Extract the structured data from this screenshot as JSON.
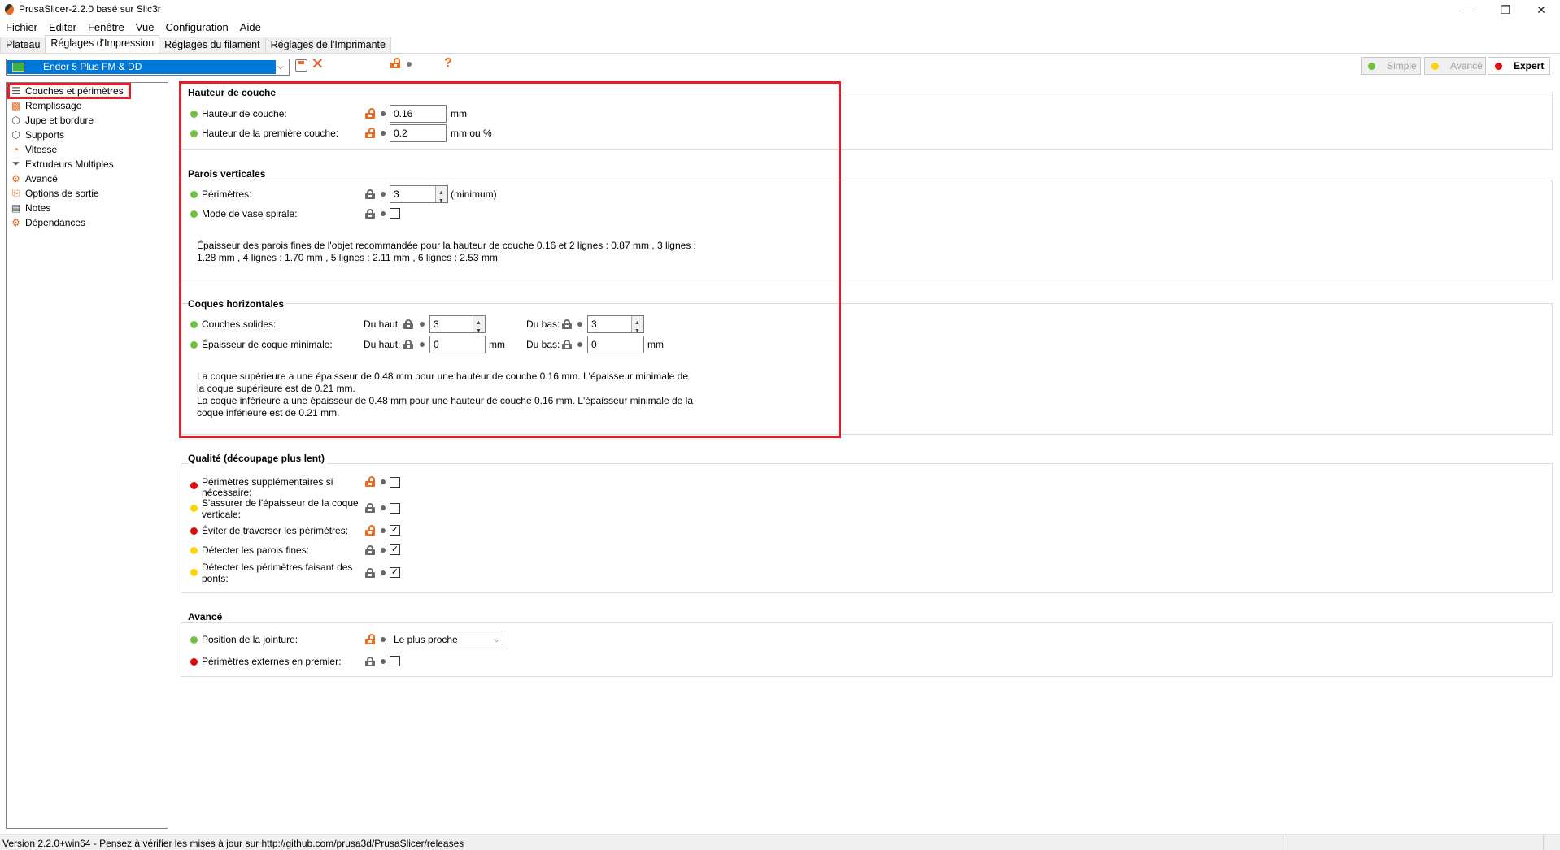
{
  "window": {
    "title": "PrusaSlicer-2.2.0 basé sur Slic3r",
    "minimize": "—",
    "restore": "❐",
    "close": "✕"
  },
  "menu": [
    "Fichier",
    "Editer",
    "Fenêtre",
    "Vue",
    "Configuration",
    "Aide"
  ],
  "tabs": [
    "Plateau",
    "Réglages d'Impression",
    "Réglages du filament",
    "Réglages de l'Imprimante"
  ],
  "toolbar": {
    "preset": "Ender 5 Plus FM & DD",
    "delete_icon": "✕",
    "help_icon": "?"
  },
  "modes": {
    "simple": "Simple",
    "advanced": "Avancé",
    "expert": "Expert",
    "colors": {
      "simple": "#6fc140",
      "advanced": "#ffd400",
      "expert": "#e30a0a"
    }
  },
  "sidebar": {
    "items": [
      {
        "label": "Couches et périmètres",
        "icon": "layers-icon"
      },
      {
        "label": "Remplissage",
        "icon": "infill-icon"
      },
      {
        "label": "Jupe et bordure",
        "icon": "skirt-icon"
      },
      {
        "label": "Supports",
        "icon": "support-icon"
      },
      {
        "label": "Vitesse",
        "icon": "speed-icon"
      },
      {
        "label": "Extrudeurs Multiples",
        "icon": "funnel-icon"
      },
      {
        "label": "Avancé",
        "icon": "wrench-icon"
      },
      {
        "label": "Options de sortie",
        "icon": "output-icon"
      },
      {
        "label": "Notes",
        "icon": "note-icon"
      },
      {
        "label": "Dépendances",
        "icon": "wrench-icon"
      }
    ]
  },
  "layer_height": {
    "title": "Hauteur de couche",
    "layer_height_label": "Hauteur de couche:",
    "layer_height_value": "0.16",
    "layer_height_unit": "mm",
    "first_layer_label": "Hauteur de la première couche:",
    "first_layer_value": "0.2",
    "first_layer_unit": "mm ou %"
  },
  "vertical_shells": {
    "title": "Parois verticales",
    "perimeters_label": "Périmètres:",
    "perimeters_value": "3",
    "perimeters_unit": "(minimum)",
    "spiral_label": "Mode de vase spirale:",
    "info_line1": "Épaisseur des parois fines de l'objet recommandée pour la hauteur de couche 0.16 et 2 lignes : 0.87 mm , 3 lignes :",
    "info_line2": "1.28 mm , 4 lignes : 1.70 mm , 5 lignes : 2.11 mm , 6 lignes : 2.53 mm"
  },
  "horizontal_shells": {
    "title": "Coques horizontales",
    "solid_layers_label": "Couches solides:",
    "top_label": "Du haut:",
    "bottom_label": "Du bas:",
    "solid_top_value": "3",
    "solid_bottom_value": "3",
    "min_thickness_label": "Épaisseur de coque minimale:",
    "min_top_value": "0",
    "min_bottom_value": "0",
    "unit": "mm",
    "info_line1": "La coque supérieure a une épaisseur de 0.48 mm pour une hauteur de couche 0.16 mm. L'épaisseur minimale de",
    "info_line2": "la coque supérieure est de 0.21 mm.",
    "info_line3": "La coque inférieure a une épaisseur de 0.48 mm pour une hauteur de couche 0.16 mm. L'épaisseur minimale de la",
    "info_line4": "coque inférieure est de 0.21 mm."
  },
  "quality": {
    "title": "Qualité (découpage plus lent)",
    "extra_perimeters_l1": "Périmètres supplémentaires si",
    "extra_perimeters_l2": "nécessaire:",
    "ensure_thickness_l1": "S'assurer de l'épaisseur de la coque",
    "ensure_thickness_l2": "verticale:",
    "avoid_crossing": "Éviter de traverser les périmètres:",
    "thin_walls": "Détecter les parois fines:",
    "bridging_l1": "Détecter les périmètres faisant des",
    "bridging_l2": "ponts:",
    "check": "✓"
  },
  "advanced": {
    "title": "Avancé",
    "seam_label": "Position de la jointure:",
    "seam_value": "Le plus proche",
    "external_first_label": "Périmètres externes en premier:"
  },
  "status": {
    "text": "Version 2.2.0+win64 - Pensez à vérifier les mises à jour sur http://github.com/prusa3d/PrusaSlicer/releases"
  }
}
